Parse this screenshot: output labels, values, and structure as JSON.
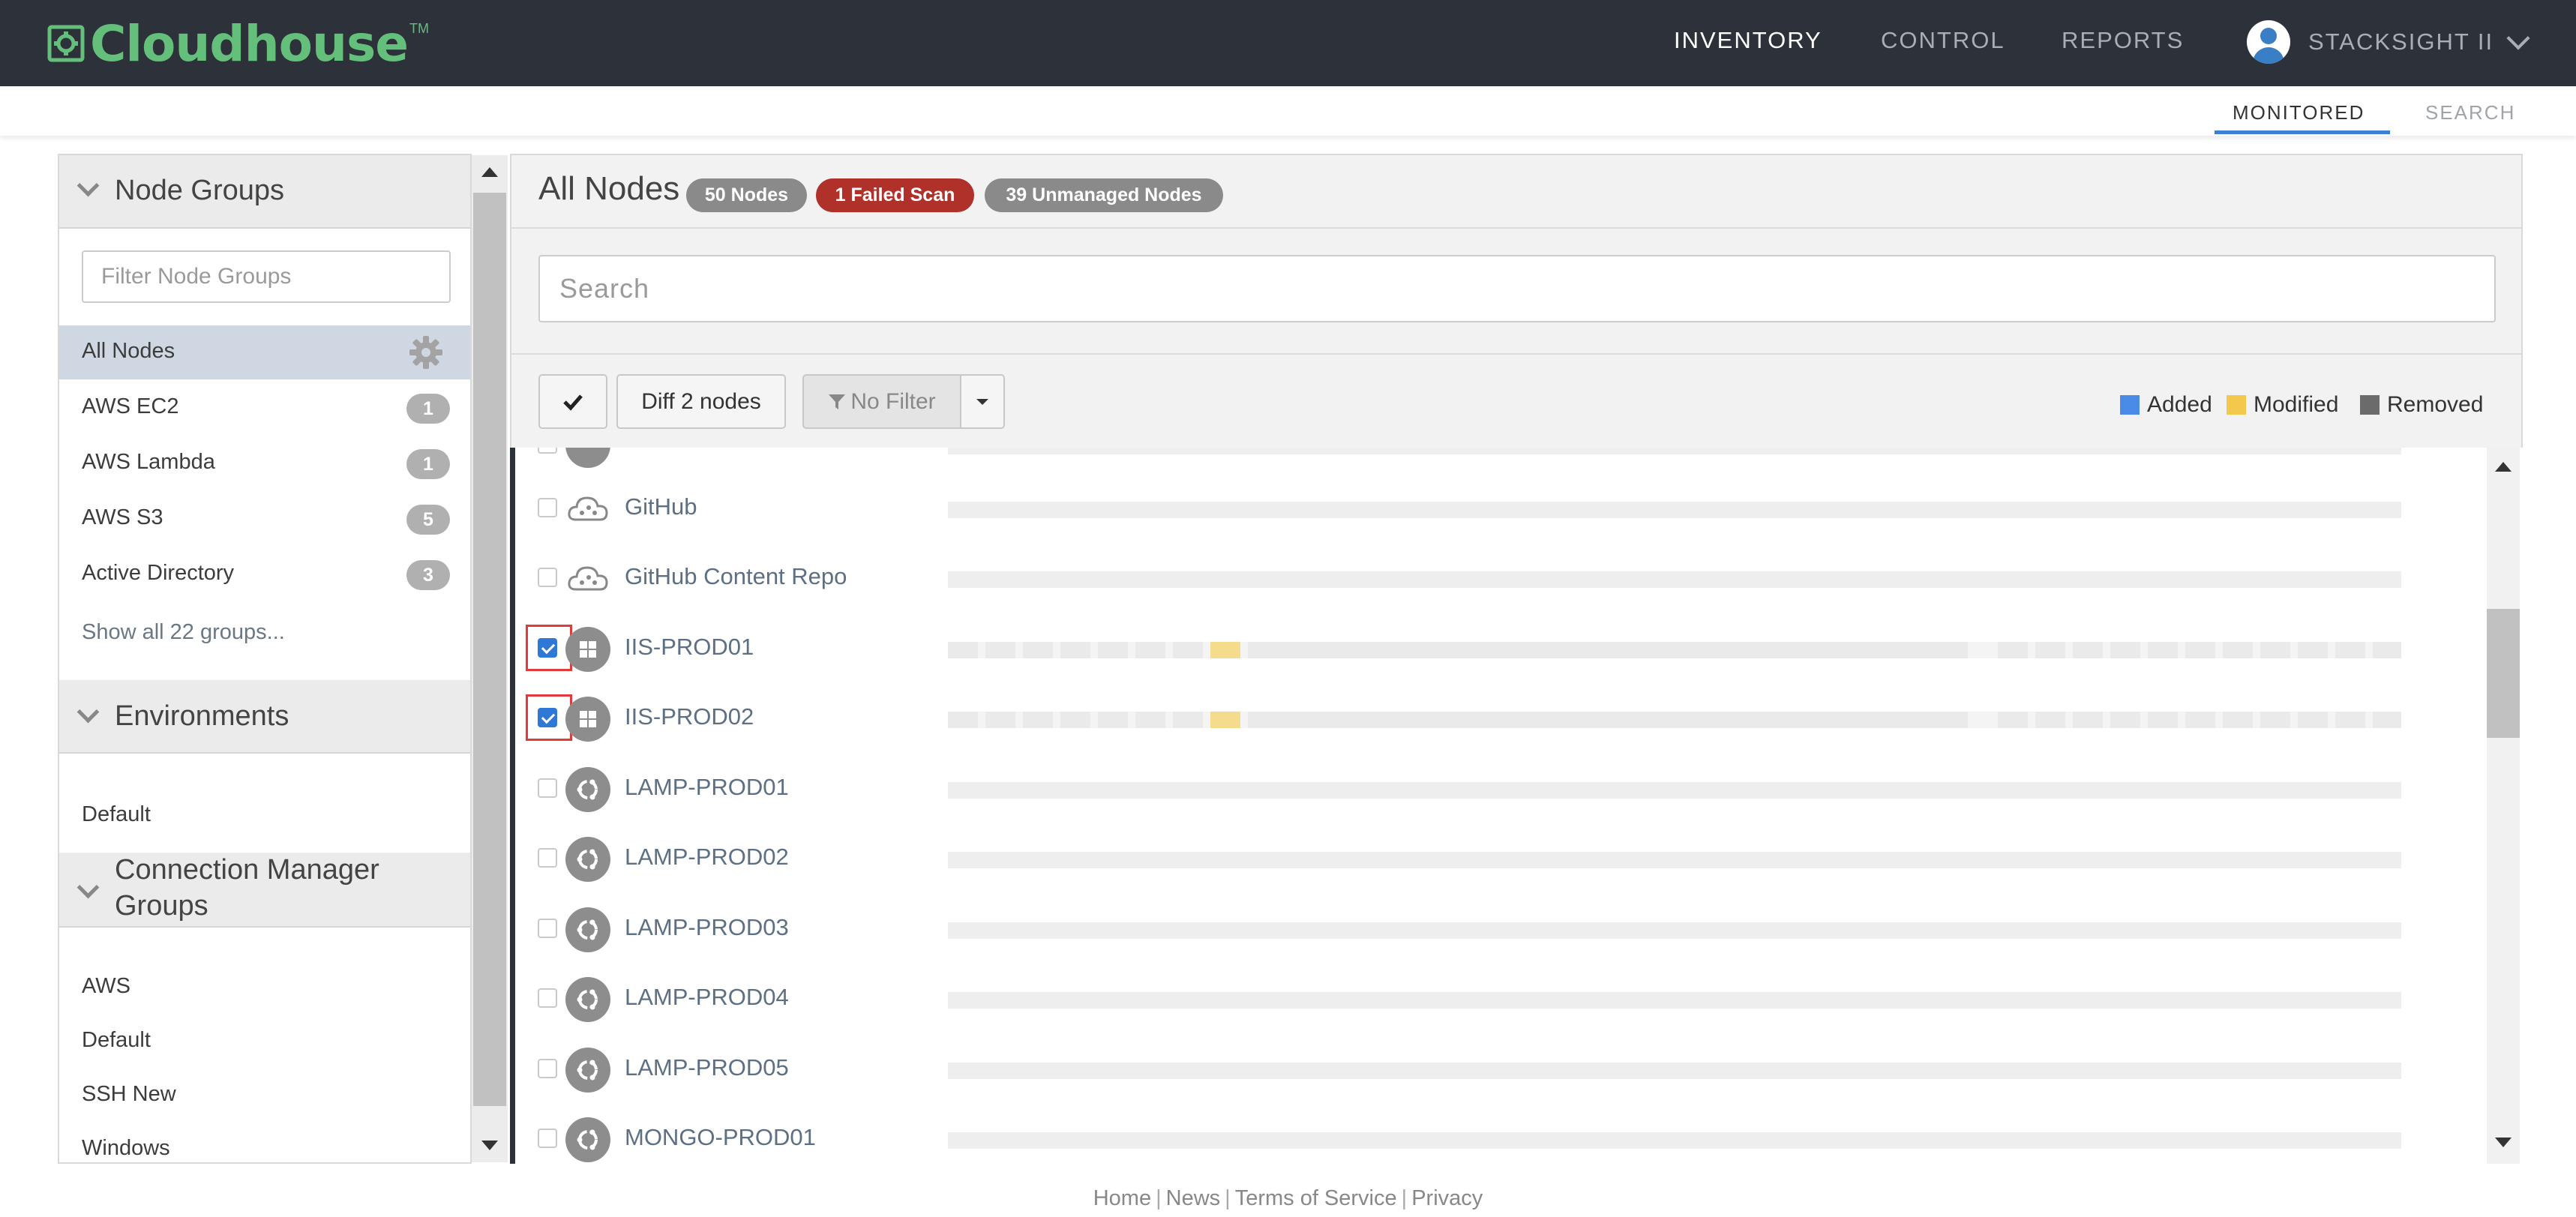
{
  "app": {
    "brand": "Cloudhouse",
    "trademark": "TM",
    "brand_color": "#64bf7a",
    "nav_bg": "#2c313a"
  },
  "nav": {
    "items": [
      {
        "label": "INVENTORY",
        "active": true
      },
      {
        "label": "CONTROL",
        "active": false
      },
      {
        "label": "REPORTS",
        "active": false
      }
    ],
    "user": "STACKSIGHT II"
  },
  "subtabs": [
    {
      "label": "MONITORED",
      "active": true
    },
    {
      "label": "SEARCH",
      "active": false
    }
  ],
  "sidebar": {
    "node_groups_title": "Node Groups",
    "filter_placeholder": "Filter Node Groups",
    "groups": [
      {
        "label": "All Nodes",
        "active": true,
        "icon": "gear-icon"
      },
      {
        "label": "AWS EC2",
        "count": "1"
      },
      {
        "label": "AWS Lambda",
        "count": "1"
      },
      {
        "label": "AWS S3",
        "count": "5"
      },
      {
        "label": "Active Directory",
        "count": "3"
      }
    ],
    "show_all": "Show all 22 groups...",
    "environments_title": "Environments",
    "environments": [
      "Default"
    ],
    "cm_title_line1": "Connection Manager",
    "cm_title_line2": "Groups",
    "cm_groups": [
      "AWS",
      "Default",
      "SSH New",
      "Windows"
    ]
  },
  "main": {
    "title": "All Nodes",
    "badges": {
      "nodes": "50 Nodes",
      "failed": "1 Failed Scan",
      "unmanaged": "39 Unmanaged Nodes"
    },
    "search_placeholder": "Search",
    "toolbar": {
      "diff_label": "Diff 2 nodes",
      "filter_label": "No Filter"
    },
    "legend": [
      {
        "label": "Added",
        "color": "#3b82f6"
      },
      {
        "label": "Modified",
        "color": "#f2c94c"
      },
      {
        "label": "Removed",
        "color": "#6b6b6b"
      }
    ]
  },
  "nodes": [
    {
      "name": "GitHub",
      "icon": "cloud-icon",
      "checked": false
    },
    {
      "name": "GitHub Content Repo",
      "icon": "cloud-icon",
      "checked": false
    },
    {
      "name": "IIS-PROD01",
      "icon": "windows-icon",
      "checked": true
    },
    {
      "name": "IIS-PROD02",
      "icon": "windows-icon",
      "checked": true
    },
    {
      "name": "LAMP-PROD01",
      "icon": "ubuntu-icon",
      "checked": false
    },
    {
      "name": "LAMP-PROD02",
      "icon": "ubuntu-icon",
      "checked": false
    },
    {
      "name": "LAMP-PROD03",
      "icon": "ubuntu-icon",
      "checked": false
    },
    {
      "name": "LAMP-PROD04",
      "icon": "ubuntu-icon",
      "checked": false
    },
    {
      "name": "LAMP-PROD05",
      "icon": "ubuntu-icon",
      "checked": false
    },
    {
      "name": "MONGO-PROD01",
      "icon": "ubuntu-icon",
      "checked": false
    }
  ],
  "footer": {
    "links": [
      "Home",
      "News",
      "Terms of Service",
      "Privacy"
    ]
  }
}
